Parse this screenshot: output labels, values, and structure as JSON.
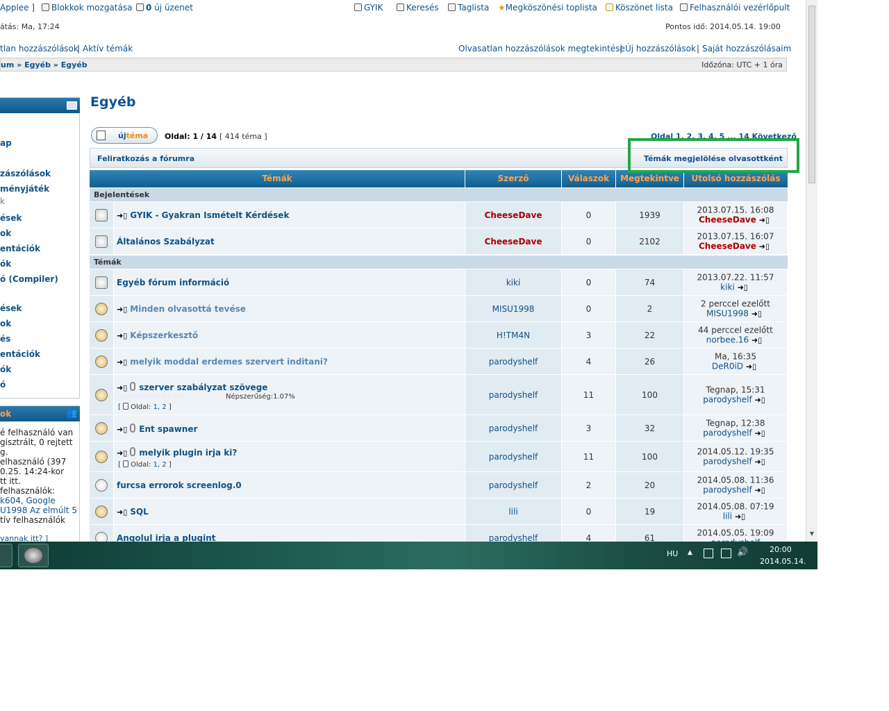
{
  "top": {
    "user_fragment": "Applee ]",
    "move_blocks": "Blokkok mozgatása",
    "messages_count": "0",
    "messages_label": "új üzenet",
    "links": [
      "GYIK",
      "Keresés",
      "Taglista",
      "Megköszönési toplista",
      "Köszönet lista",
      "Felhasználói vezérlőpult"
    ],
    "last_visit": "átás: Ma, 17:24",
    "current_time": "Pontos idő: 2014.05.14. 19:00",
    "left_links": [
      "tlan hozzászólások",
      "Aktív témák"
    ],
    "right_links": [
      "Olvasatlan hozzászólások megtekintése",
      "Új hozzászólások",
      "Saját hozzászólásaim"
    ],
    "breadcrumb": [
      "um",
      "Egyéb",
      "Egyéb"
    ],
    "timezone": "Időzóna: UTC + 1 óra"
  },
  "sidebar": {
    "menu_items": [
      "ap",
      "zászólások",
      "ményjáték",
      "k",
      "ések",
      "ok",
      "entációk",
      "ók",
      "ó (Compiler)",
      "ések",
      "ok",
      "és",
      "entációk",
      "ók",
      "ó"
    ],
    "who_title": "ok",
    "who_lines": [
      "é felhasználó van",
      "gisztrált, 0 rejtett",
      "g.",
      "elhasználó (397",
      "0.25. 14:24-kor",
      "tt itt.",
      "felhasználók:",
      "k604, Google",
      "U1998 Az elmúlt 5",
      "tív felhasználók",
      "vannak itt? ]"
    ]
  },
  "forum": {
    "title": "Egyéb",
    "new_topic_prefix": "új",
    "new_topic_suffix": "téma",
    "page_label": "Oldal:",
    "page_value": "1 / 14",
    "topic_count": "[ 414 téma ]",
    "pagination": "Oldal 1, 2, 3, 4, 5 ... 14  Következő",
    "subscribe": "Feliratkozás a fórumra",
    "mark_read": "Témák megjelölése olvasottként",
    "headers": [
      "Témák",
      "Szerző",
      "Válaszok",
      "Megtekintve",
      "Utolsó hozzászólás"
    ],
    "section_announcements": "Bejelentések",
    "section_topics": "Témák",
    "pages_label": "Oldal:",
    "popularity": "Népszerűség:1.07%"
  },
  "announcements": [
    {
      "title": "GYIK - Gyakran Ismételt Kérdések",
      "author": "CheeseDave",
      "replies": "0",
      "views": "1939",
      "last_date": "2013.07.15. 16:08",
      "last_by": "CheeseDave"
    },
    {
      "title": "Általános Szabályzat",
      "author": "CheeseDave",
      "replies": "0",
      "views": "2102",
      "last_date": "2013.07.15. 16:07",
      "last_by": "CheeseDave"
    }
  ],
  "topics": [
    {
      "title": "Egyéb fórum információ",
      "author": "kiki",
      "replies": "0",
      "views": "74",
      "last_date": "2013.07.22. 11:57",
      "last_by": "kiki"
    },
    {
      "title": "Minden olvasottá tevése",
      "author": "MISU1998",
      "replies": "0",
      "views": "2",
      "last_date": "2 perccel ezelőtt",
      "last_by": "MISU1998"
    },
    {
      "title": "Képszerkesztő",
      "author": "H!TM4N",
      "replies": "3",
      "views": "22",
      "last_date": "44 perccel ezelőtt",
      "last_by": "norbee.16"
    },
    {
      "title": "melyik moddal erdemes szervert inditani?",
      "author": "parodyshelf",
      "replies": "4",
      "views": "26",
      "last_date": "Ma, 16:35",
      "last_by": "DeR0iD"
    },
    {
      "title": "szerver szabályzat szövege",
      "author": "parodyshelf",
      "replies": "11",
      "views": "100",
      "last_date": "Tegnap, 15:31",
      "last_by": "parodyshelf",
      "pages": "1, 2"
    },
    {
      "title": "Ent spawner",
      "author": "parodyshelf",
      "replies": "3",
      "views": "32",
      "last_date": "Tegnap, 12:38",
      "last_by": "parodyshelf"
    },
    {
      "title": "melyik plugin irja ki?",
      "author": "parodyshelf",
      "replies": "11",
      "views": "100",
      "last_date": "2014.05.12. 19:35",
      "last_by": "parodyshelf",
      "pages": "1, 2"
    },
    {
      "title": "furcsa errorok screenlog.0",
      "author": "parodyshelf",
      "replies": "2",
      "views": "20",
      "last_date": "2014.05.08. 11:36",
      "last_by": "parodyshelf"
    },
    {
      "title": "SQL",
      "author": "lili",
      "replies": "0",
      "views": "19",
      "last_date": "2014.05.08. 07:19",
      "last_by": "lili"
    },
    {
      "title": "Angolul irja a plugint",
      "author": "parodyshelf",
      "replies": "4",
      "views": "61",
      "last_date": "2014.05.05. 19:09",
      "last_by": "parodyshelf"
    }
  ],
  "taskbar": {
    "lang": "HU",
    "time": "20:00",
    "date": "2014.05.14."
  },
  "colors": {
    "accent": "#105289",
    "header_text": "#ffa34f",
    "highlight": "#22a64a"
  }
}
